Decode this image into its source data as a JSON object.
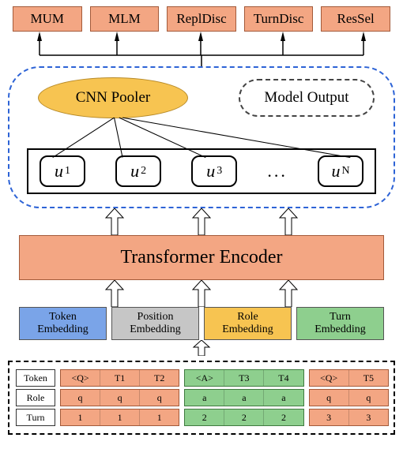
{
  "tasks": {
    "t0": "MUM",
    "t1": "MLM",
    "t2": "ReplDisc",
    "t3": "TurnDisc",
    "t4": "ResSel"
  },
  "panel": {
    "cnn": "CNN Pooler",
    "modelout": "Model Output",
    "u1": "u",
    "u1sub": "1",
    "u2": "u",
    "u2sub": "2",
    "u3": "u",
    "u3sub": "3",
    "dots": "...",
    "un": "u",
    "unsub": "N"
  },
  "encoder": "Transformer Encoder",
  "emb": {
    "token": "Token\nEmbedding",
    "pos": "Position\nEmbedding",
    "role": "Role\nEmbedding",
    "turn": "Turn\nEmbedding"
  },
  "inputs": {
    "labels": {
      "token": "Token",
      "role": "Role",
      "turn": "Turn"
    },
    "token": {
      "g1": {
        "c0": "<Q>",
        "c1": "T1",
        "c2": "T2"
      },
      "g2": {
        "c0": "<A>",
        "c1": "T3",
        "c2": "T4"
      },
      "g3": {
        "c0": "<Q>",
        "c1": "T5"
      }
    },
    "role": {
      "g1": {
        "c0": "q",
        "c1": "q",
        "c2": "q"
      },
      "g2": {
        "c0": "a",
        "c1": "a",
        "c2": "a"
      },
      "g3": {
        "c0": "q",
        "c1": "q"
      }
    },
    "turn": {
      "g1": {
        "c0": "1",
        "c1": "1",
        "c2": "1"
      },
      "g2": {
        "c0": "2",
        "c1": "2",
        "c2": "2"
      },
      "g3": {
        "c0": "3",
        "c1": "3"
      }
    }
  },
  "chart_data": {
    "type": "diagram",
    "title": "Model architecture with pre-training tasks",
    "tasks": [
      "MUM",
      "MLM",
      "ReplDisc",
      "TurnDisc",
      "ResSel"
    ],
    "outputs": {
      "cnn_pooler_over": [
        "u1",
        "u2",
        "u3",
        "...",
        "uN"
      ],
      "also": "Model Output"
    },
    "encoder": "Transformer Encoder",
    "embeddings": [
      "Token Embedding",
      "Position Embedding",
      "Role Embedding",
      "Turn Embedding"
    ],
    "example_inputs": {
      "tokens": [
        [
          "<Q>",
          "T1",
          "T2"
        ],
        [
          "<A>",
          "T3",
          "T4"
        ],
        [
          "<Q>",
          "T5"
        ]
      ],
      "roles": [
        [
          "q",
          "q",
          "q"
        ],
        [
          "a",
          "a",
          "a"
        ],
        [
          "q",
          "q"
        ]
      ],
      "turns": [
        [
          "1",
          "1",
          "1"
        ],
        [
          "2",
          "2",
          "2"
        ],
        [
          "3",
          "3"
        ]
      ]
    }
  }
}
